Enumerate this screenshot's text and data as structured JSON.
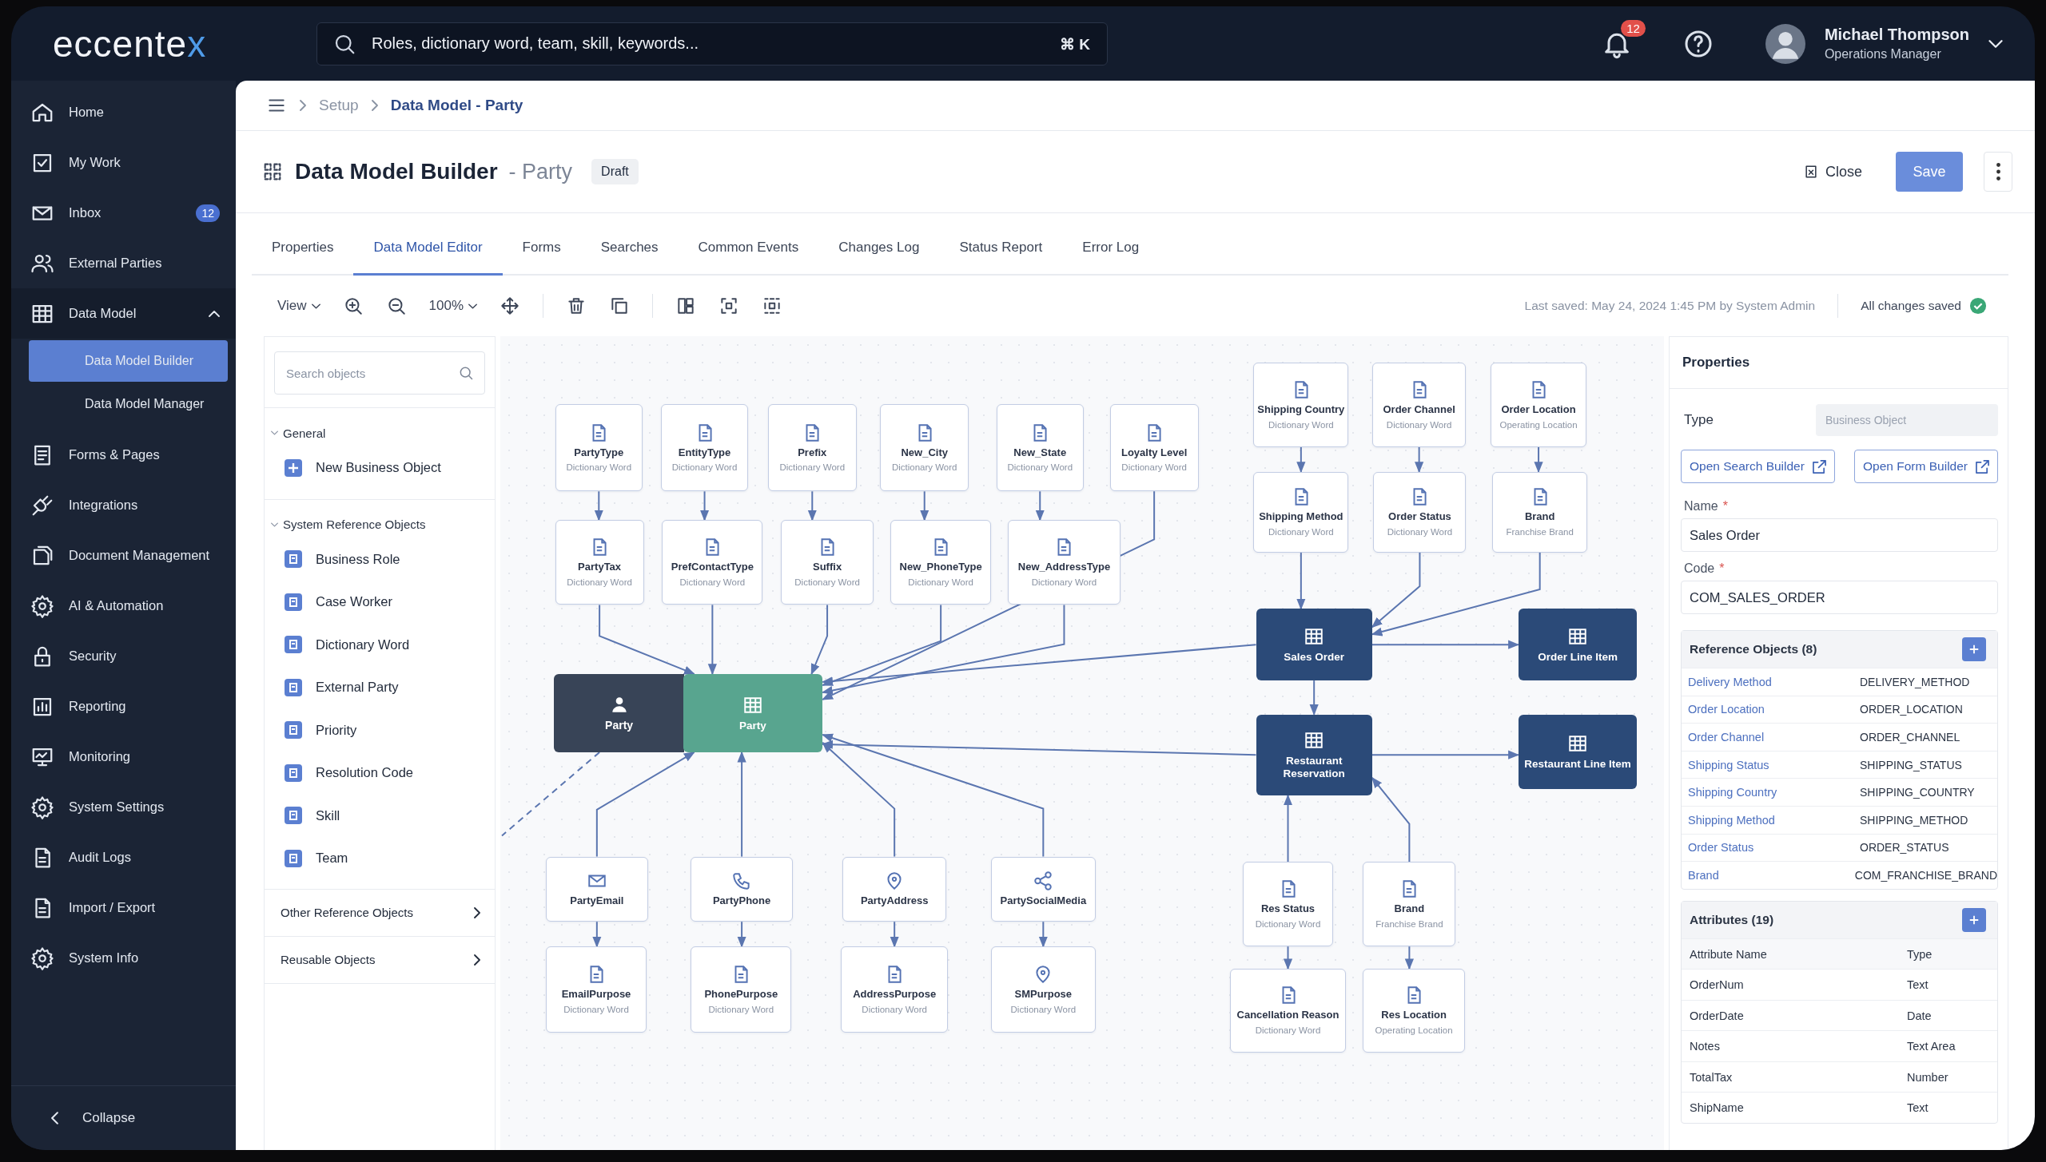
{
  "header": {
    "logo": {
      "text": "eccente",
      "accent": "x"
    },
    "search": {
      "placeholder": "Roles, dictionary word, team, skill, keywords...",
      "shortcut": "⌘ K"
    },
    "notifications": "12",
    "user": {
      "name": "Michael Thompson",
      "role": "Operations Manager"
    }
  },
  "sidebar": {
    "items": [
      {
        "label": "Home",
        "selected": false
      },
      {
        "label": "My Work",
        "selected": false
      },
      {
        "label": "Inbox",
        "selected": false,
        "badge": "12"
      },
      {
        "label": "External Parties",
        "selected": false
      },
      {
        "label": "Data Model",
        "selected": false,
        "expanded": true,
        "children": [
          {
            "label": "Data Model Builder",
            "selected": true
          },
          {
            "label": "Data Model Manager",
            "selected": false
          }
        ]
      },
      {
        "label": "Forms & Pages",
        "selected": false
      },
      {
        "label": "Integrations",
        "selected": false
      },
      {
        "label": "Document Management",
        "selected": false
      },
      {
        "label": "AI & Automation",
        "selected": false
      },
      {
        "label": "Security",
        "selected": false
      },
      {
        "label": "Reporting",
        "selected": false
      },
      {
        "label": "Monitoring",
        "selected": false
      },
      {
        "label": "System Settings",
        "selected": false
      },
      {
        "label": "Audit Logs",
        "selected": false
      },
      {
        "label": "Import / Export",
        "selected": false
      },
      {
        "label": "System Info",
        "selected": false
      }
    ],
    "collapse": "Collapse"
  },
  "breadcrumb": {
    "items": [
      "Setup"
    ],
    "current": "Data Model - Party"
  },
  "title": {
    "text": "Data Model Builder",
    "subtitle": "- Party",
    "badge": "Draft",
    "close": "Close",
    "save": "Save"
  },
  "tabs": [
    {
      "label": "Properties",
      "selected": false
    },
    {
      "label": "Data Model Editor",
      "selected": true
    },
    {
      "label": "Forms",
      "selected": false
    },
    {
      "label": "Searches",
      "selected": false
    },
    {
      "label": "Common Events",
      "selected": false
    },
    {
      "label": "Changes Log",
      "selected": false
    },
    {
      "label": "Status Report",
      "selected": false
    },
    {
      "label": "Error Log",
      "selected": false
    }
  ],
  "toolbar": {
    "view": "View",
    "zoom": "100%",
    "last_saved": "Last saved: May 24, 2024 1:45 PM by System Admin",
    "status": "All changes saved"
  },
  "objects_panel": {
    "search": {
      "placeholder": "Search objects"
    },
    "sections": [
      {
        "title": "General",
        "expanded": true,
        "kind": "list",
        "items": [
          "New Business Object"
        ]
      },
      {
        "title": "System Reference Objects",
        "expanded": true,
        "kind": "list",
        "items": [
          "Business Role",
          "Case Worker",
          "Dictionary Word",
          "External Party",
          "Priority",
          "Resolution Code",
          "Skill",
          "Team"
        ]
      },
      {
        "title": "Other Reference Objects",
        "expanded": false,
        "kind": "link"
      },
      {
        "title": "Reusable Objects",
        "expanded": false,
        "kind": "link"
      }
    ]
  },
  "canvas": {
    "nodes": [
      {
        "name": "PartyType",
        "subtitle": "Dictionary Word",
        "kind": "reference",
        "selected": false
      },
      {
        "name": "EntityType",
        "subtitle": "Dictionary Word",
        "kind": "reference",
        "selected": false
      },
      {
        "name": "Prefix",
        "subtitle": "Dictionary Word",
        "kind": "reference",
        "selected": false
      },
      {
        "name": "New_City",
        "subtitle": "Dictionary Word",
        "kind": "reference",
        "selected": false
      },
      {
        "name": "New_State",
        "subtitle": "Dictionary Word",
        "kind": "reference",
        "selected": false
      },
      {
        "name": "Loyalty Level",
        "subtitle": "Dictionary Word",
        "kind": "reference",
        "selected": false
      },
      {
        "name": "PartyTax",
        "subtitle": "Dictionary Word",
        "kind": "reference",
        "selected": false
      },
      {
        "name": "PrefContactType",
        "subtitle": "Dictionary Word",
        "kind": "reference",
        "selected": false
      },
      {
        "name": "Suffix",
        "subtitle": "Dictionary Word",
        "kind": "reference",
        "selected": false
      },
      {
        "name": "New_PhoneType",
        "subtitle": "Dictionary Word",
        "kind": "reference",
        "selected": false
      },
      {
        "name": "New_AddressType",
        "subtitle": "Dictionary Word",
        "kind": "reference",
        "selected": false
      },
      {
        "name": "Party",
        "kind": "actor",
        "selected": false
      },
      {
        "name": "Party",
        "kind": "entity",
        "selected": true
      },
      {
        "name": "PartyEmail",
        "kind": "reference",
        "selected": false
      },
      {
        "name": "PartyPhone",
        "kind": "reference",
        "selected": false
      },
      {
        "name": "PartyAddress",
        "kind": "reference",
        "selected": false
      },
      {
        "name": "PartySocialMedia",
        "kind": "reference",
        "selected": false
      },
      {
        "name": "EmailPurpose",
        "subtitle": "Dictionary Word",
        "kind": "reference",
        "selected": false
      },
      {
        "name": "PhonePurpose",
        "subtitle": "Dictionary Word",
        "kind": "reference",
        "selected": false
      },
      {
        "name": "AddressPurpose",
        "subtitle": "Dictionary Word",
        "kind": "reference",
        "selected": false
      },
      {
        "name": "SMPurpose",
        "subtitle": "Dictionary Word",
        "kind": "reference",
        "selected": false
      },
      {
        "name": "Shipping Country",
        "subtitle": "Dictionary Word",
        "kind": "reference",
        "selected": false
      },
      {
        "name": "Order Channel",
        "subtitle": "Dictionary Word",
        "kind": "reference",
        "selected": false
      },
      {
        "name": "Order Location",
        "subtitle": "Operating Location",
        "kind": "reference",
        "selected": false
      },
      {
        "name": "Shipping Method",
        "subtitle": "Dictionary Word",
        "kind": "reference",
        "selected": false
      },
      {
        "name": "Order Status",
        "subtitle": "Dictionary Word",
        "kind": "reference",
        "selected": false
      },
      {
        "name": "Brand",
        "subtitle": "Franchise Brand",
        "kind": "reference",
        "selected": false
      },
      {
        "name": "Sales Order",
        "kind": "entity",
        "selected": false
      },
      {
        "name": "Order Line Item",
        "kind": "entity",
        "selected": false
      },
      {
        "name": "Restaurant Reservation",
        "kind": "entity",
        "selected": false
      },
      {
        "name": "Restaurant Line Item",
        "kind": "entity",
        "selected": false
      },
      {
        "name": "Res Status",
        "subtitle": "Dictionary Word",
        "kind": "reference",
        "selected": false
      },
      {
        "name": "Brand",
        "subtitle": "Franchise Brand",
        "kind": "reference",
        "selected": false
      },
      {
        "name": "Cancellation Reason",
        "subtitle": "Dictionary Word",
        "kind": "reference",
        "selected": false
      },
      {
        "name": "Res Location",
        "subtitle": "Operating Location",
        "kind": "reference",
        "selected": false
      }
    ]
  },
  "properties": {
    "title": "Properties",
    "type": {
      "label": "Type",
      "value": "Business Object"
    },
    "buttons": [
      "Open Search Builder",
      "Open Form Builder"
    ],
    "fields": [
      {
        "label": "Name",
        "required_mark": "*",
        "value": "Sales Order"
      },
      {
        "label": "Code",
        "required_mark": "*",
        "value": "COM_SALES_ORDER"
      }
    ],
    "reference_objects": {
      "title": "Reference Objects (8)",
      "rows": [
        {
          "name": "Delivery Method",
          "code": "DELIVERY_METHOD"
        },
        {
          "name": "Order Location",
          "code": "ORDER_LOCATION"
        },
        {
          "name": "Order Channel",
          "code": "ORDER_CHANNEL"
        },
        {
          "name": "Shipping Status",
          "code": "SHIPPING_STATUS"
        },
        {
          "name": "Shipping Country",
          "code": "SHIPPING_COUNTRY"
        },
        {
          "name": "Shipping Method",
          "code": "SHIPPING_METHOD"
        },
        {
          "name": "Order Status",
          "code": "ORDER_STATUS"
        },
        {
          "name": "Brand",
          "code": "COM_FRANCHISE_BRAND"
        }
      ]
    },
    "attributes": {
      "title": "Attributes (19)",
      "columns": [
        "Attribute Name",
        "Type"
      ],
      "rows": [
        [
          "OrderNum",
          "Text"
        ],
        [
          "OrderDate",
          "Date"
        ],
        [
          "Notes",
          "Text Area"
        ],
        [
          "TotalTax",
          "Number"
        ],
        [
          "ShipName",
          "Text"
        ]
      ]
    }
  }
}
